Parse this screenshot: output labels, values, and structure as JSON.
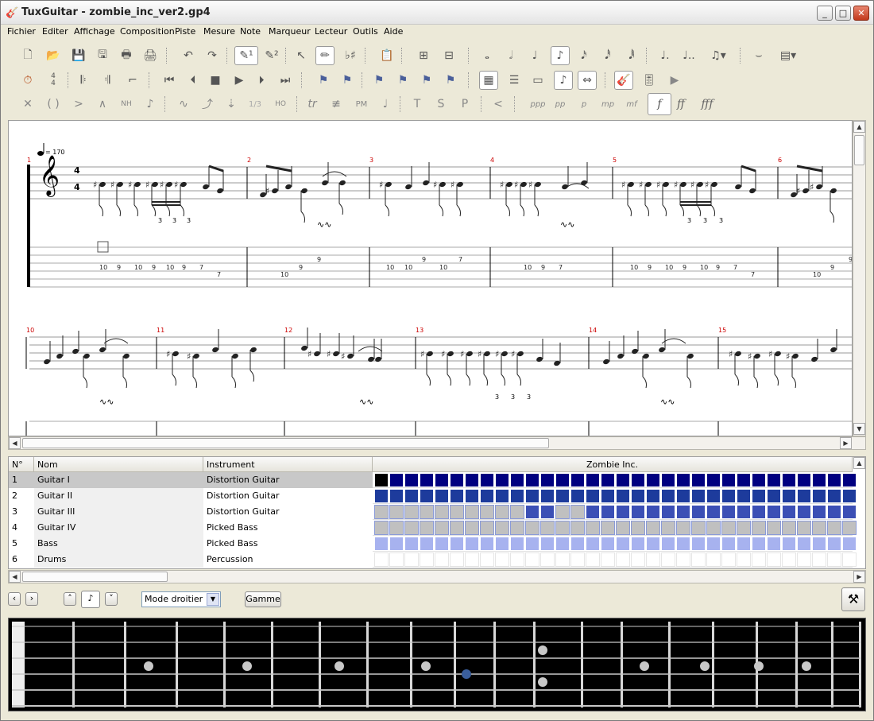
{
  "window": {
    "app_icon": "tuxguitar-icon",
    "title": "TuxGuitar - zombie_inc_ver2.gp4",
    "buttons": [
      "_",
      "□",
      "✕"
    ]
  },
  "menu": [
    "Fichier",
    "Editer",
    "Affichage",
    "Composition",
    "Piste",
    "Mesure",
    "Note",
    "Marqueur",
    "Lecteur",
    "Outils",
    "Aide"
  ],
  "toolbar": {
    "row1": [
      "new-file",
      "open-file",
      "save-file",
      "save-as",
      "print",
      "print-preview",
      "undo",
      "redo",
      "edit-mode-1",
      "edit-mode-2",
      "select-tool",
      "pencil-tool",
      "accidental-tool",
      "clipboard",
      "insert-measure",
      "remove-measure",
      "whole",
      "half",
      "quarter",
      "eighth",
      "sixteenth",
      "thirty-second",
      "sixty-fourth",
      "dotted",
      "double-dotted",
      "tuplet",
      "tie",
      "chord"
    ],
    "row2": [
      "metronome",
      "time-signature",
      "repeat-open",
      "repeat-close",
      "alternative-ending",
      "first",
      "previous",
      "stop",
      "play",
      "next",
      "last",
      "marker-1",
      "marker-2",
      "marker-3",
      "marker-4",
      "marker-5",
      "marker-6",
      "marker-7",
      "score-view",
      "tab-view",
      "compact-view",
      "note-view",
      "mirror-view",
      "instrument",
      "mixer",
      "transport"
    ],
    "row3": {
      "effects": [
        "dead-note",
        "ghost-note",
        "accent",
        "heavy-accent",
        "harmonic",
        "grace",
        "slide",
        "bend",
        "let-ring",
        "tuplet-1-3",
        "hammer-on",
        "trill",
        "tremolo",
        "palm-mute",
        "staccato",
        "tapping",
        "slapping",
        "popping",
        "fade-in"
      ],
      "effect_labels": {
        "harmonic": "NH",
        "tuplet": "1/3",
        "hammer": "HO",
        "trill": "tr",
        "palm": "PM",
        "tap": "T",
        "slap": "S",
        "pop": "P"
      },
      "dynamics": [
        "ppp",
        "pp",
        "p",
        "mp",
        "mf",
        "f",
        "ff",
        "fff"
      ],
      "selected_dynamic": "f"
    }
  },
  "score": {
    "tempo": "= 170",
    "time_signature_top": "4",
    "time_signature_bottom": "4",
    "system1_measures": [
      "1",
      "2",
      "3",
      "4",
      "5",
      "6"
    ],
    "system2_measures": [
      "10",
      "11",
      "12",
      "13",
      "14",
      "15"
    ],
    "triplet_label": "3",
    "tab_row1": [
      {
        "m": 1,
        "frets": [
          "10",
          "9",
          "10",
          "9",
          "10",
          "9",
          "7",
          "7"
        ]
      },
      {
        "m": 2,
        "frets": [
          "10",
          "9",
          "9"
        ]
      },
      {
        "m": 3,
        "frets": [
          "10",
          "10",
          "9",
          "10",
          "7"
        ]
      },
      {
        "m": 4,
        "frets": [
          "10",
          "9",
          "7"
        ]
      },
      {
        "m": 5,
        "frets": [
          "10",
          "9",
          "10",
          "9",
          "10",
          "9",
          "7",
          "7"
        ]
      },
      {
        "m": 6,
        "frets": [
          "10",
          "9",
          "9"
        ]
      }
    ]
  },
  "tracks": {
    "headers": {
      "number": "N°",
      "name": "Nom",
      "instrument": "Instrument",
      "song": "Zombie Inc."
    },
    "rows": [
      {
        "n": "1",
        "name": "Guitar I",
        "instrument": "Distortion Guitar",
        "color": "#1f1f99",
        "selected": true
      },
      {
        "n": "2",
        "name": "Guitar II",
        "instrument": "Distortion Guitar",
        "color": "#2a3a9f",
        "selected": false
      },
      {
        "n": "3",
        "name": "Guitar III",
        "instrument": "Distortion Guitar",
        "color": "#3a4bb0",
        "selected": false
      },
      {
        "n": "4",
        "name": "Guitar IV",
        "instrument": "Picked Bass",
        "color": "#c0c0c0",
        "selected": false
      },
      {
        "n": "5",
        "name": "Bass",
        "instrument": "Picked Bass",
        "color": "#aab0ee",
        "selected": false
      },
      {
        "n": "6",
        "name": "Drums",
        "instrument": "Percussion",
        "color": "#ffffff",
        "selected": false
      }
    ]
  },
  "fretbar": {
    "hand_mode": "Mode droitier",
    "scale_button": "Gamme"
  },
  "fretboard": {
    "inlay_frets": [
      "3",
      "5",
      "7",
      "9",
      "12",
      "15",
      "17",
      "19",
      "21"
    ],
    "double_fret": "12",
    "selected_fret": "10",
    "strings": 6
  }
}
